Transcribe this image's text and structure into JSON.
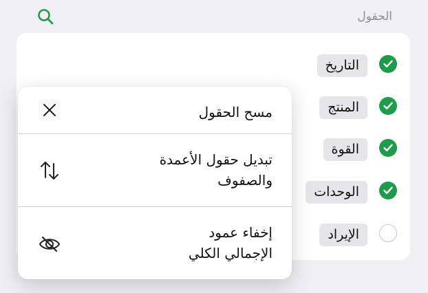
{
  "header": {
    "title": "الحقول",
    "search_icon": "search-icon"
  },
  "colors": {
    "accent": "#1e9b4b",
    "chip_bg": "#e5e5ea",
    "page_bg": "#efeff4"
  },
  "fields": [
    {
      "label": "التاريخ",
      "checked": true
    },
    {
      "label": "المنتج",
      "checked": true
    },
    {
      "label": "القوة",
      "checked": true
    },
    {
      "label": "الوحدات",
      "checked": true
    },
    {
      "label": "الإيراد",
      "checked": false
    }
  ],
  "menu": {
    "items": [
      {
        "label": "مسح الحقول",
        "icon": "close-icon"
      },
      {
        "label": "تبديل حقول الأعمدة\nوالصفوف",
        "icon": "swap-arrows-icon"
      },
      {
        "label": "إخفاء عمود\nالإجمالي الكلي",
        "icon": "eye-slash-icon"
      }
    ]
  }
}
